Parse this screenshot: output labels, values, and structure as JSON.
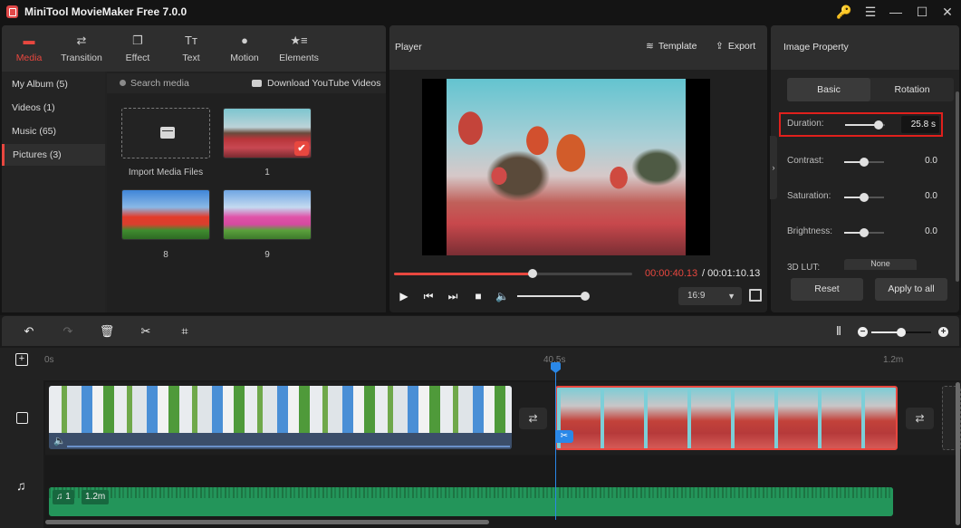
{
  "app": {
    "title": "MiniTool MovieMaker Free 7.0.0",
    "window_controls": {
      "key": "🔑",
      "menu": "☰",
      "minimize": "—",
      "maximize": "☐",
      "close": "✕"
    }
  },
  "toolbar": {
    "tabs": [
      {
        "label": "Media",
        "icon": "folder-icon",
        "glyph": "▬",
        "active": true
      },
      {
        "label": "Transition",
        "icon": "swap-icon",
        "glyph": "⇄"
      },
      {
        "label": "Effect",
        "icon": "layers-icon",
        "glyph": "❐"
      },
      {
        "label": "Text",
        "icon": "text-icon",
        "glyph": "Tт"
      },
      {
        "label": "Motion",
        "icon": "motion-icon",
        "glyph": "●"
      },
      {
        "label": "Elements",
        "icon": "elements-icon",
        "glyph": "★≡"
      }
    ]
  },
  "sidebar": {
    "items": [
      {
        "label": "My Album (5)"
      },
      {
        "label": "Videos (1)"
      },
      {
        "label": "Music (65)"
      },
      {
        "label": "Pictures (3)",
        "active": true
      }
    ]
  },
  "media": {
    "search_placeholder": "Search media",
    "download_label": "Download YouTube Videos",
    "import_label": "Import Media Files",
    "items": [
      {
        "label": "1",
        "selected": true,
        "check": "✔"
      },
      {
        "label": "8"
      },
      {
        "label": "9"
      }
    ]
  },
  "player": {
    "title": "Player",
    "template_label": "Template",
    "template_glyph": "≋",
    "export_label": "Export",
    "export_glyph": "⇪",
    "time_current": "00:00:40.13",
    "time_total": "/ 00:01:10.13",
    "progress_fraction": 0.58,
    "volume_fraction": 1.0,
    "aspect_ratio": "16:9",
    "controls": {
      "play": "▶",
      "prev": "⏮",
      "next": "⏭",
      "stop": "■",
      "volume": "🔈"
    }
  },
  "property": {
    "title": "Image Property",
    "tabs": [
      {
        "label": "Basic",
        "active": true
      },
      {
        "label": "Rotation"
      }
    ],
    "rows": [
      {
        "label": "Duration:",
        "value": "25.8 s",
        "fraction": 0.85
      },
      {
        "label": "Contrast:",
        "value": "0.0",
        "fraction": 0.5
      },
      {
        "label": "Saturation:",
        "value": "0.0",
        "fraction": 0.5
      },
      {
        "label": "Brightness:",
        "value": "0.0",
        "fraction": 0.5
      }
    ],
    "lut_label": "3D LUT:",
    "lut_value": "None",
    "reset_label": "Reset",
    "apply_label": "Apply to all",
    "collapse_glyph": "›"
  },
  "timeline": {
    "tools": {
      "undo": "↶",
      "redo": "↷",
      "delete": "🗑",
      "cut": "✂",
      "crop": "⌗",
      "fit": "⦀"
    },
    "zoom_fraction": 0.5,
    "ruler": [
      {
        "label": "0s"
      },
      {
        "label": "40.5s"
      },
      {
        "label": "1.2m"
      }
    ],
    "transition_glyph": "⇄",
    "split_glyph": "✂",
    "music_clip": {
      "index": "1",
      "duration": "1.2m",
      "glyph": "♫"
    },
    "clip_volume_glyph": "🔈",
    "add_track_glyph": "+",
    "music_track_glyph": "♫"
  }
}
